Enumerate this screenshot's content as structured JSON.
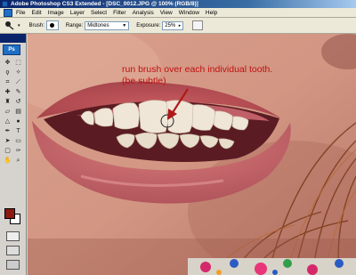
{
  "window": {
    "title": "Adobe Photoshop CS3 Extended - [DSC_0012.JPG @ 100% (RGB/8)]"
  },
  "menu": {
    "items": [
      "File",
      "Edit",
      "Image",
      "Layer",
      "Select",
      "Filter",
      "Analysis",
      "View",
      "Window",
      "Help"
    ]
  },
  "options": {
    "brush_label": "Brush:",
    "brush_size": "9",
    "range_label": "Range:",
    "range_value": "Midtones",
    "exposure_label": "Exposure:",
    "exposure_value": "25%"
  },
  "toolbox": {
    "badge": "Ps",
    "tools": [
      "move-icon",
      "marquee-icon",
      "lasso-icon",
      "magic-wand-icon",
      "crop-icon",
      "slice-icon",
      "healing-icon",
      "brush-icon",
      "stamp-icon",
      "history-brush-icon",
      "eraser-icon",
      "gradient-icon",
      "dodge-icon",
      "blur-icon",
      "pen-icon",
      "type-icon",
      "path-select-icon",
      "shape-icon",
      "notes-icon",
      "eyedropper-icon",
      "hand-icon",
      "zoom-icon"
    ],
    "foreground_color": "#8b1a12",
    "background_color": "#ffffff"
  },
  "annotation": {
    "line1": "run brush over each individual tooth.",
    "line2": "(be subtle)",
    "color": "#c01010"
  }
}
